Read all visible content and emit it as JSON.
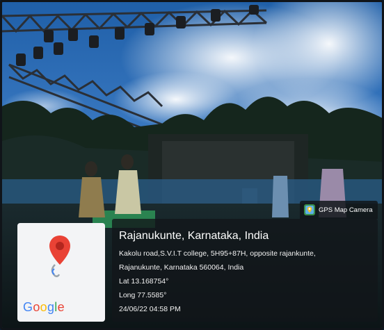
{
  "badge": {
    "label": "GPS Map Camera",
    "icon": "gps-map-camera-icon"
  },
  "map_card": {
    "icon": "map-pin-icon",
    "brand_letters": [
      "G",
      "o",
      "o",
      "g",
      "l",
      "e"
    ],
    "brand_colors": [
      "#4285F4",
      "#EA4335",
      "#FBBC05",
      "#4285F4",
      "#34A853",
      "#EA4335"
    ]
  },
  "location": {
    "title": "Rajanukunte, Karnataka, India",
    "address_line1": "Kakolu road,S.V.I.T college, 5H95+87H, opposite rajankunte,",
    "address_line2": "Rajanukunte, Karnataka 560064, India",
    "lat": "Lat 13.168754°",
    "long": "Long 77.5585°",
    "datetime": "24/06/22 04:58 PM"
  },
  "colors": {
    "pin_red": "#E94235",
    "overlay": "#12161a"
  }
}
